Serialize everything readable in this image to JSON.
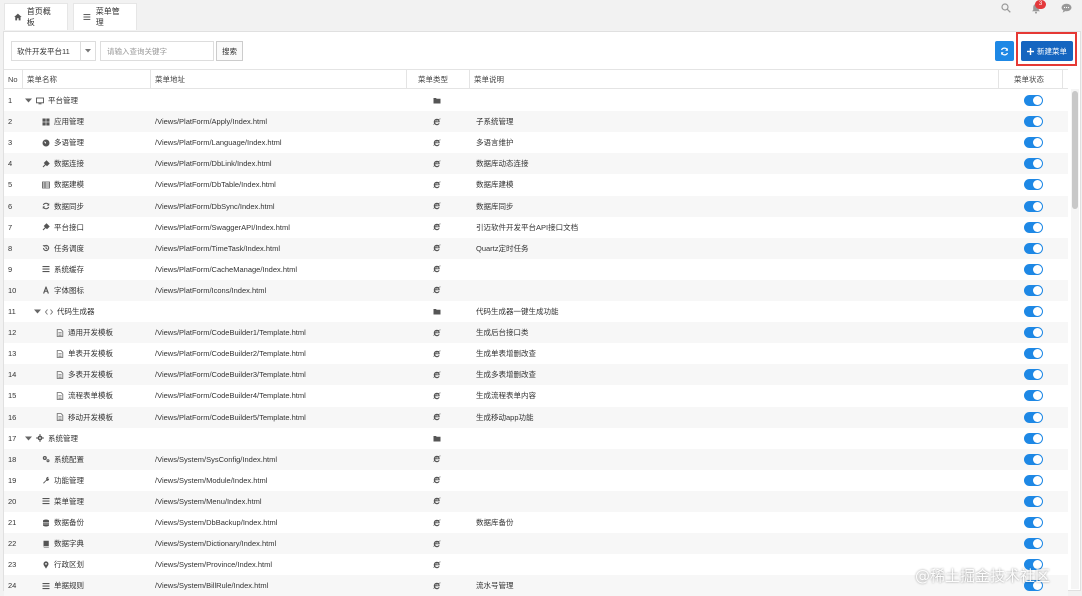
{
  "tabs": [
    {
      "label": "首页概板",
      "icon": "home-icon"
    },
    {
      "label": "菜单管理",
      "icon": "list-icon"
    }
  ],
  "top_icons": {
    "notification_badge": "3"
  },
  "toolbar": {
    "platform_select": "软件开发平台11",
    "search_placeholder": "请输入查询关键字",
    "search_label": "搜索",
    "new_menu_label": "新建菜单"
  },
  "columns": {
    "no": "No",
    "name": "菜单名称",
    "url": "菜单地址",
    "type": "菜单类型",
    "desc": "菜单说明",
    "status": "菜单状态"
  },
  "rows": [
    {
      "no": "1",
      "name": "平台管理",
      "url": "",
      "type": "folder",
      "desc": "",
      "icon": "monitor-icon",
      "level": 0,
      "expanded": true
    },
    {
      "no": "2",
      "name": "应用管理",
      "url": "/Views/PlatForm/Apply/Index.html",
      "type": "page",
      "desc": "子系统管理",
      "icon": "windows-icon",
      "level": 1
    },
    {
      "no": "3",
      "name": "多语管理",
      "url": "/Views/PlatForm/Language/Index.html",
      "type": "page",
      "desc": "多语言维护",
      "icon": "globe-icon",
      "level": 1
    },
    {
      "no": "4",
      "name": "数据连接",
      "url": "/Views/PlatForm/DbLink/Index.html",
      "type": "page",
      "desc": "数据库动态连接",
      "icon": "plug-icon",
      "level": 1
    },
    {
      "no": "5",
      "name": "数据建模",
      "url": "/Views/PlatForm/DbTable/Index.html",
      "type": "page",
      "desc": "数据库建模",
      "icon": "table-icon",
      "level": 1
    },
    {
      "no": "6",
      "name": "数据同步",
      "url": "/Views/PlatForm/DbSync/Index.html",
      "type": "page",
      "desc": "数据库同步",
      "icon": "sync-icon",
      "level": 1
    },
    {
      "no": "7",
      "name": "平台接口",
      "url": "/Views/PlatForm/SwaggerAPI/Index.html",
      "type": "page",
      "desc": "引迈软件开发平台API接口文档",
      "icon": "plug-icon",
      "level": 1
    },
    {
      "no": "8",
      "name": "任务调度",
      "url": "/Views/PlatForm/TimeTask/Index.html",
      "type": "page",
      "desc": "Quartz定时任务",
      "icon": "history-icon",
      "level": 1
    },
    {
      "no": "9",
      "name": "系统缓存",
      "url": "/Views/PlatForm/CacheManage/Index.html",
      "type": "page",
      "desc": "",
      "icon": "list-icon",
      "level": 1
    },
    {
      "no": "10",
      "name": "字体图标",
      "url": "/Views/PlatForm/Icons/Index.html",
      "type": "page",
      "desc": "",
      "icon": "font-icon",
      "level": 1
    },
    {
      "no": "11",
      "name": "代码生成器",
      "url": "",
      "type": "folder",
      "desc": "代码生成器一键生成功能",
      "icon": "code-icon",
      "level": 1,
      "expanded": true
    },
    {
      "no": "12",
      "name": "通用开发模板",
      "url": "/Views/PlatForm/CodeBuilder1/Template.html",
      "type": "page",
      "desc": "生成后台接口类",
      "icon": "file-icon",
      "level": 2
    },
    {
      "no": "13",
      "name": "单表开发模板",
      "url": "/Views/PlatForm/CodeBuilder2/Template.html",
      "type": "page",
      "desc": "生成单表增删改查",
      "icon": "file-icon",
      "level": 2
    },
    {
      "no": "14",
      "name": "多表开发模板",
      "url": "/Views/PlatForm/CodeBuilder3/Template.html",
      "type": "page",
      "desc": "生成多表增删改查",
      "icon": "file-icon",
      "level": 2
    },
    {
      "no": "15",
      "name": "流程表单模板",
      "url": "/Views/PlatForm/CodeBuilder4/Template.html",
      "type": "page",
      "desc": "生成流程表单内容",
      "icon": "file-icon",
      "level": 2
    },
    {
      "no": "16",
      "name": "移动开发模板",
      "url": "/Views/PlatForm/CodeBuilder5/Template.html",
      "type": "page",
      "desc": "生成移动app功能",
      "icon": "file-icon",
      "level": 2
    },
    {
      "no": "17",
      "name": "系统管理",
      "url": "",
      "type": "folder",
      "desc": "",
      "icon": "gear-icon",
      "level": 0,
      "expanded": true
    },
    {
      "no": "18",
      "name": "系统配置",
      "url": "/Views/System/SysConfig/Index.html",
      "type": "page",
      "desc": "",
      "icon": "gears-icon",
      "level": 1
    },
    {
      "no": "19",
      "name": "功能管理",
      "url": "/Views/System/Module/Index.html",
      "type": "page",
      "desc": "",
      "icon": "wrench-icon",
      "level": 1
    },
    {
      "no": "20",
      "name": "菜单管理",
      "url": "/Views/System/Menu/Index.html",
      "type": "page",
      "desc": "",
      "icon": "list-icon",
      "level": 1
    },
    {
      "no": "21",
      "name": "数据备份",
      "url": "/Views/System/DbBackup/Index.html",
      "type": "page",
      "desc": "数据库备份",
      "icon": "database-icon",
      "level": 1
    },
    {
      "no": "22",
      "name": "数据字典",
      "url": "/Views/System/Dictionary/Index.html",
      "type": "page",
      "desc": "",
      "icon": "book-icon",
      "level": 1
    },
    {
      "no": "23",
      "name": "行政区划",
      "url": "/Views/System/Province/Index.html",
      "type": "page",
      "desc": "",
      "icon": "map-marker-icon",
      "level": 1
    },
    {
      "no": "24",
      "name": "单据规则",
      "url": "/Views/System/BillRule/Index.html",
      "type": "page",
      "desc": "流水号管理",
      "icon": "list-icon",
      "level": 1
    }
  ],
  "watermark": "@稀土掘金技术社区",
  "colors": {
    "accent": "#1e88e5",
    "primary_button": "#1565c0",
    "highlight_border": "#e53935"
  }
}
